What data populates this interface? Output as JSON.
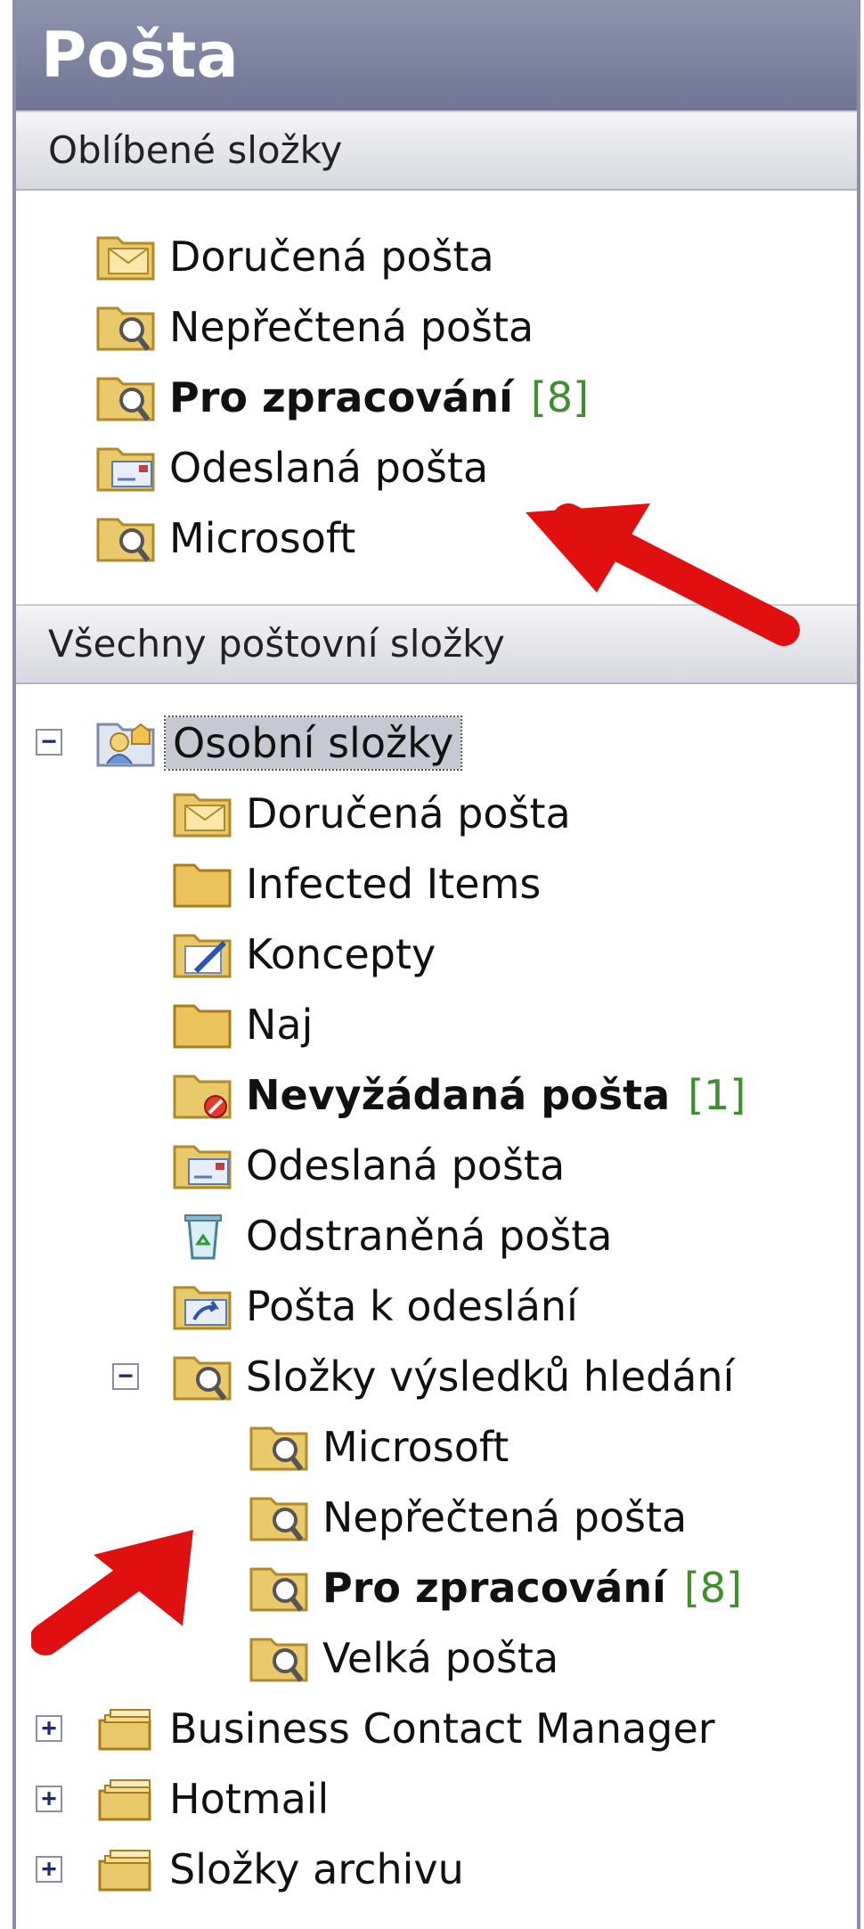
{
  "pane": {
    "title": "Pošta"
  },
  "favorites": {
    "header": "Oblíbené složky",
    "items": [
      {
        "label": "Doručená pošta",
        "icon": "inbox-folder-icon"
      },
      {
        "label": "Nepřečtená pošta",
        "icon": "search-folder-icon"
      },
      {
        "label": "Pro zpracování",
        "count": "[8]",
        "icon": "search-folder-icon"
      },
      {
        "label": "Odeslaná pošta",
        "icon": "sent-folder-icon"
      },
      {
        "label": "Microsoft",
        "icon": "search-folder-icon"
      }
    ]
  },
  "all_folders": {
    "header": "Všechny poštovní složky",
    "root": {
      "label": "Osobní složky",
      "icon": "personal-folders-icon",
      "expander": "−"
    },
    "items": [
      {
        "label": "Doručená pošta",
        "icon": "inbox-folder-icon"
      },
      {
        "label": "Infected Items",
        "icon": "folder-icon"
      },
      {
        "label": "Koncepty",
        "icon": "drafts-folder-icon"
      },
      {
        "label": "Naj",
        "icon": "folder-icon"
      },
      {
        "label": "Nevyžádaná pošta",
        "count": "[1]",
        "icon": "junk-folder-icon"
      },
      {
        "label": "Odeslaná pošta",
        "icon": "sent-folder-icon"
      },
      {
        "label": "Odstraněná pošta",
        "icon": "recycle-bin-icon"
      },
      {
        "label": "Pošta k odeslání",
        "icon": "outbox-folder-icon"
      }
    ],
    "search_root": {
      "label": "Složky výsledků hledání",
      "icon": "search-folder-icon",
      "expander": "−"
    },
    "search_items": [
      {
        "label": "Microsoft",
        "icon": "search-folder-icon"
      },
      {
        "label": "Nepřečtená pošta",
        "icon": "search-folder-icon"
      },
      {
        "label": "Pro zpracování",
        "count": "[8]",
        "icon": "search-folder-icon"
      },
      {
        "label": "Velká pošta",
        "icon": "search-folder-icon"
      }
    ],
    "other_roots": [
      {
        "label": "Business Contact Manager",
        "icon": "archive-folder-icon",
        "expander": "+"
      },
      {
        "label": "Hotmail",
        "icon": "archive-folder-icon",
        "expander": "+"
      },
      {
        "label": "Složky archivu",
        "icon": "archive-folder-icon",
        "expander": "+"
      }
    ]
  },
  "colors": {
    "count": "#3f8f2f",
    "arrow": "#e01010",
    "title_bar": "#7b809e"
  }
}
